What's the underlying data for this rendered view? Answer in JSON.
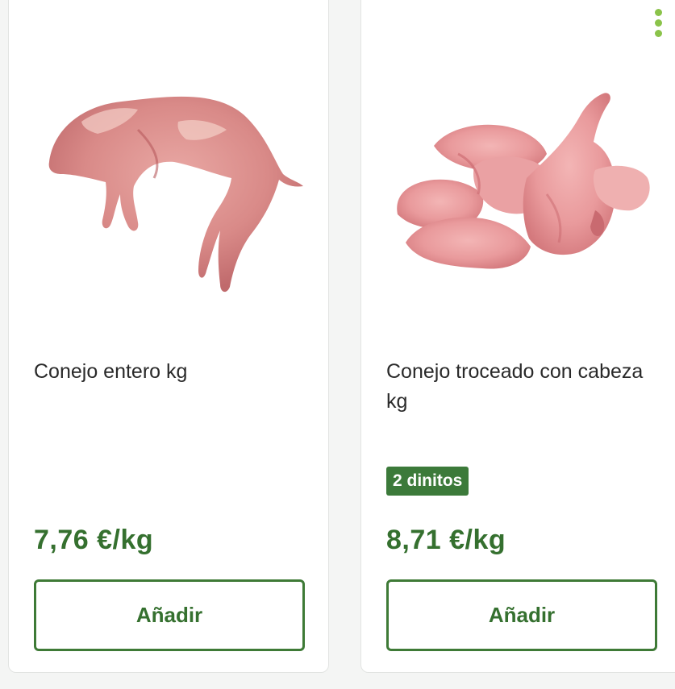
{
  "products": [
    {
      "title": "Conejo entero kg",
      "badge": "",
      "price": "7,76 €/kg",
      "add_label": "Añadir",
      "image_icon": "whole-rabbit-meat-image"
    },
    {
      "title": "Conejo troceado con cabeza kg",
      "badge": "2 dinitos",
      "price": "8,71 €/kg",
      "add_label": "Añadir",
      "image_icon": "chopped-rabbit-meat-image"
    }
  ],
  "colors": {
    "accent_green": "#35702f",
    "menu_dots": "#8bc34a",
    "badge_bg": "#3c7a3a"
  },
  "icons": {
    "more_menu": "more-vertical-icon"
  }
}
